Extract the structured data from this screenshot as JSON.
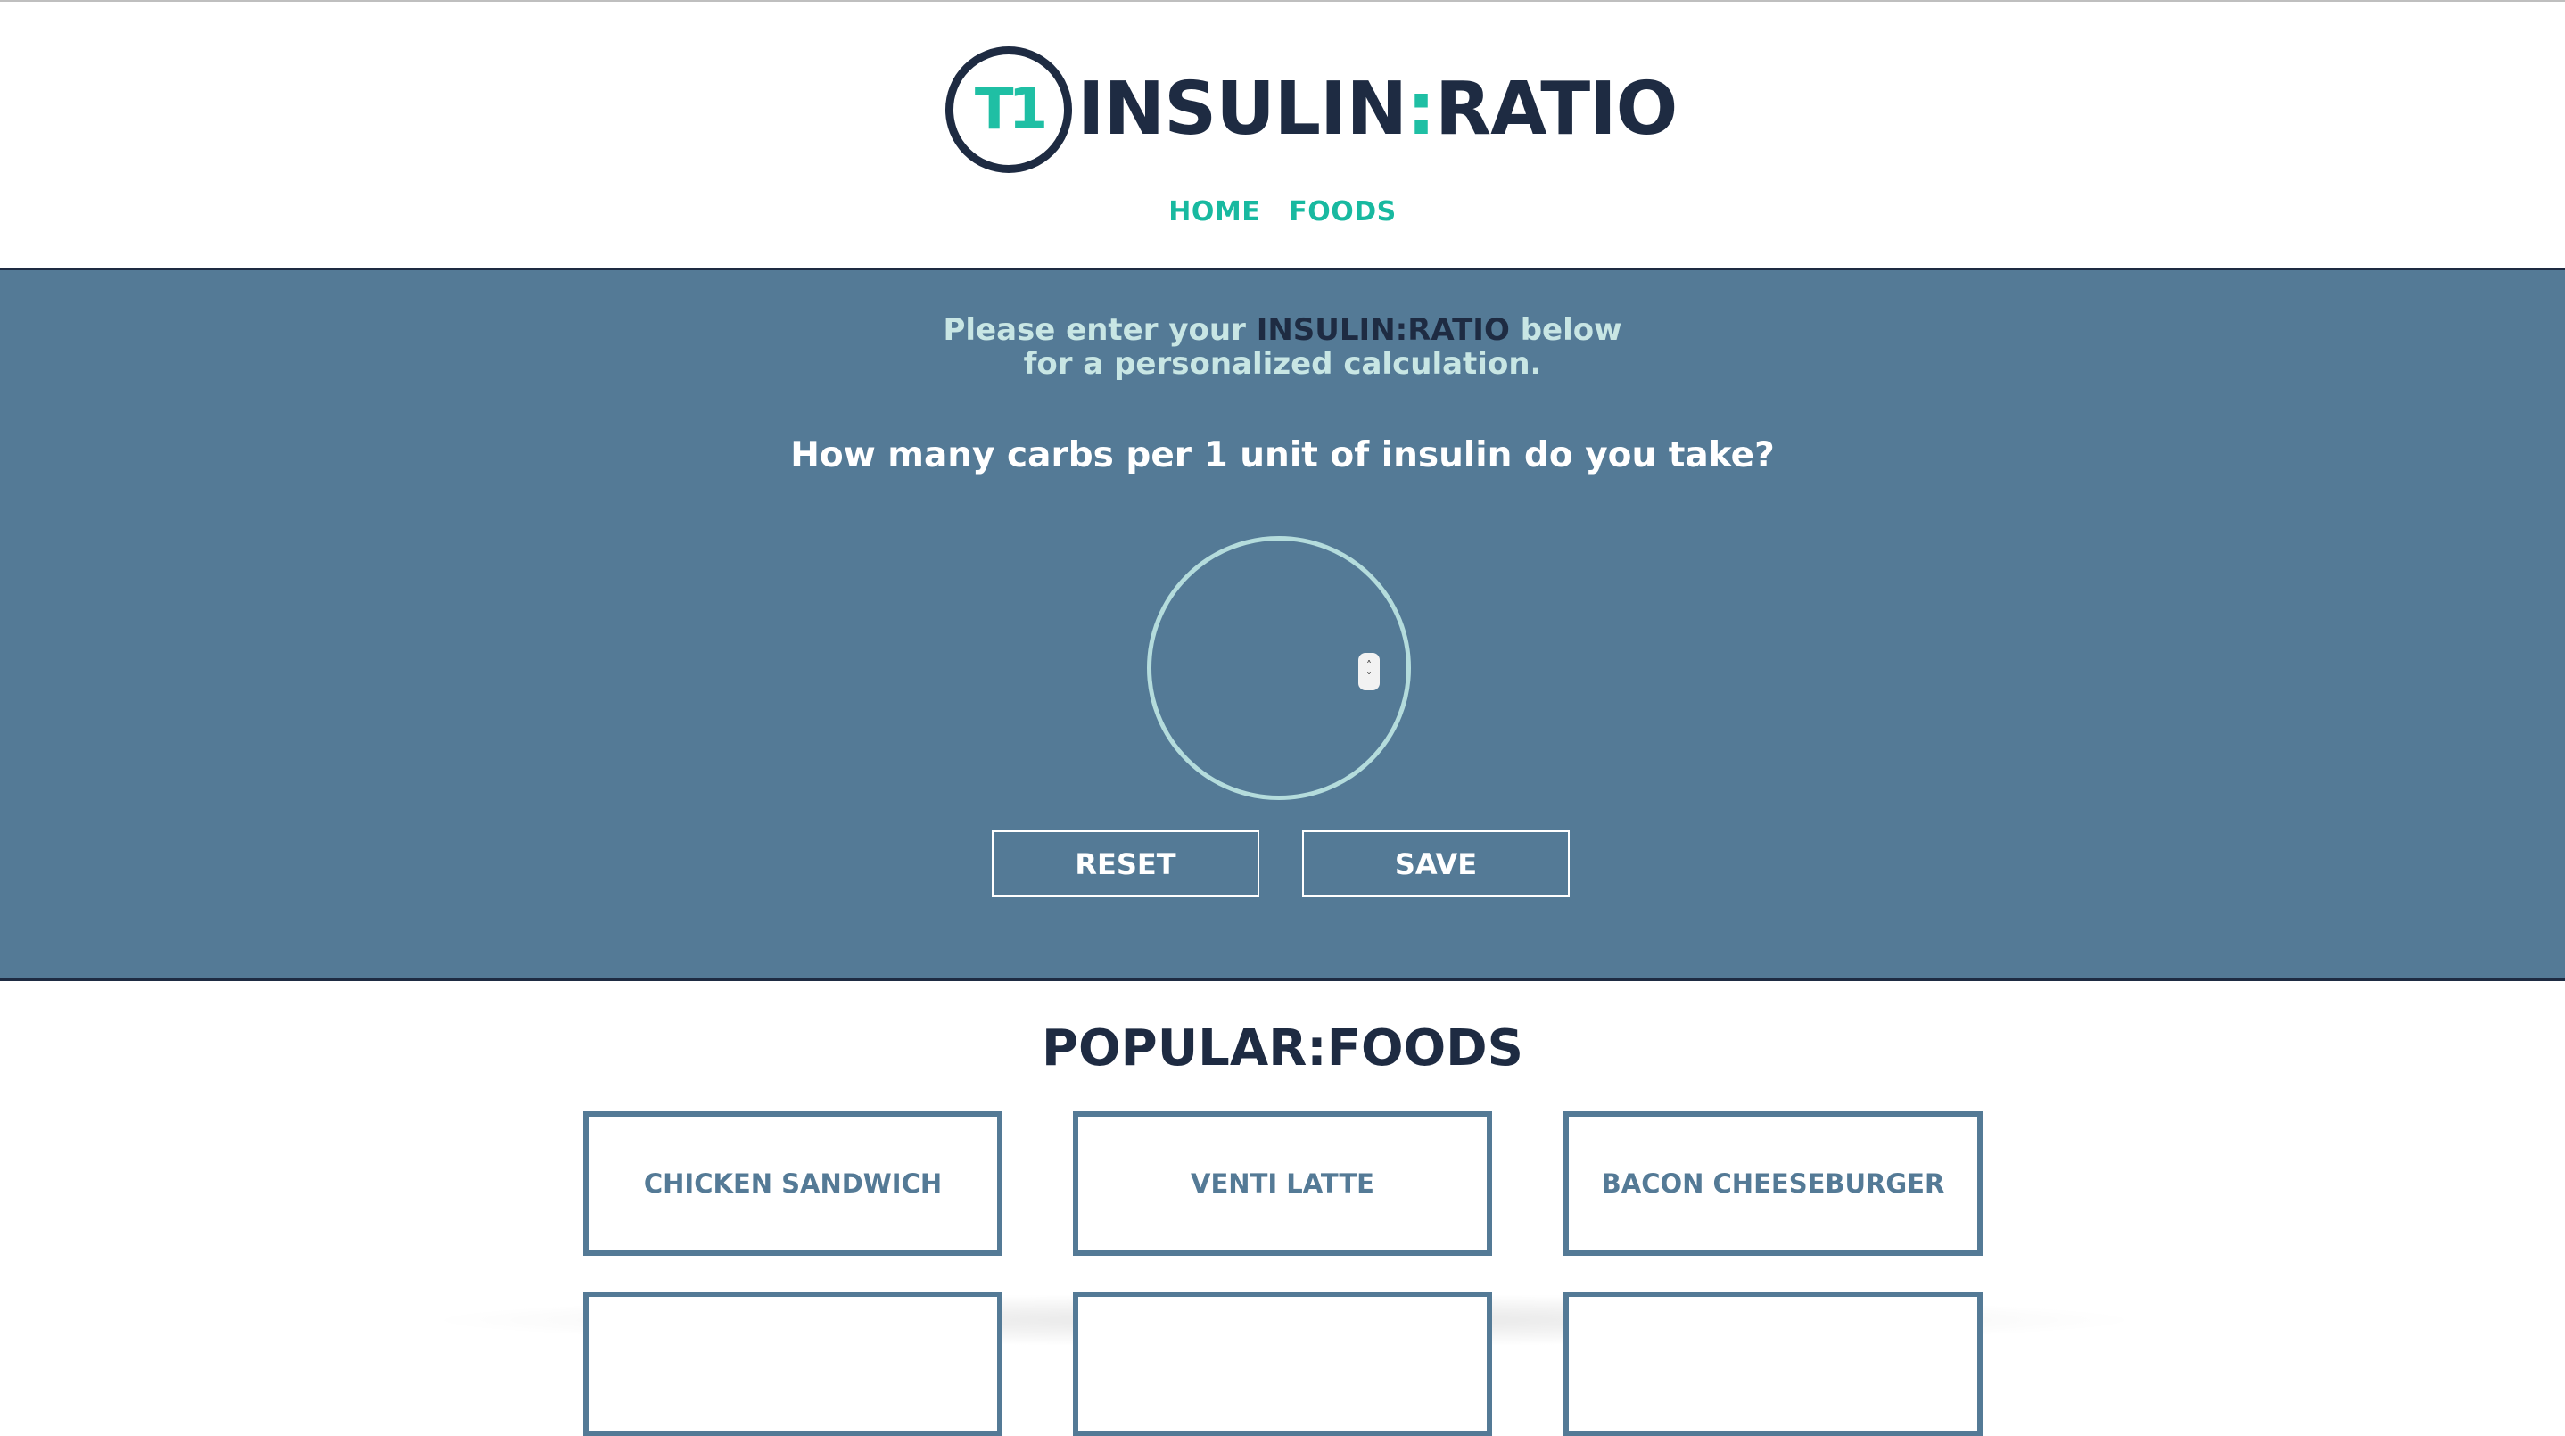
{
  "logo": {
    "badge": "T1",
    "word_left": "INSULIN",
    "colon": ":",
    "word_right": "RATIO"
  },
  "nav": [
    {
      "label": "HOME"
    },
    {
      "label": "FOODS"
    }
  ],
  "hero": {
    "intro_prefix": "Please enter your ",
    "intro_brand": "INSULIN:RATIO",
    "intro_suffix": " below",
    "intro_line2": "for a personalized calculation.",
    "question": "How many carbs per 1 unit of insulin do you take?",
    "ratio_value": "",
    "reset_label": "RESET",
    "save_label": "SAVE"
  },
  "popular": {
    "title": "POPULAR:FOODS",
    "items": [
      {
        "label": "CHICKEN SANDWICH"
      },
      {
        "label": "VENTI LATTE"
      },
      {
        "label": "BACON CHEESEBURGER"
      },
      {
        "label": ""
      },
      {
        "label": ""
      },
      {
        "label": ""
      }
    ]
  },
  "colors": {
    "navy": "#1e2b42",
    "teal": "#1fbfa4",
    "hero_bg": "#547a96",
    "dial": "#b4dcdc"
  }
}
